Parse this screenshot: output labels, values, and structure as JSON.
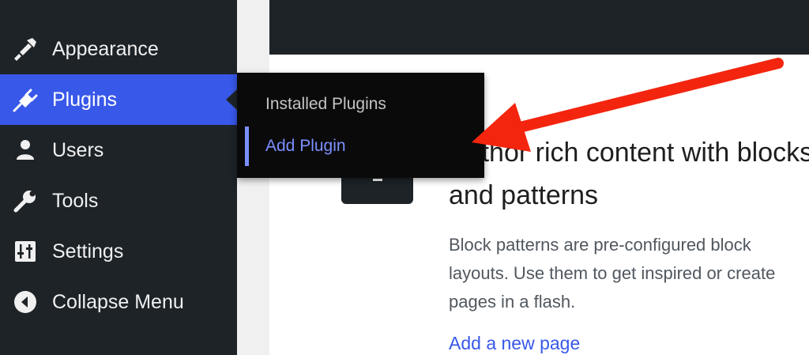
{
  "sidebar": {
    "items": [
      {
        "label": "Appearance",
        "icon": "paintbrush-icon"
      },
      {
        "label": "Plugins",
        "icon": "plugin-icon",
        "active": true
      },
      {
        "label": "Users",
        "icon": "user-icon"
      },
      {
        "label": "Tools",
        "icon": "wrench-icon"
      },
      {
        "label": "Settings",
        "icon": "settings-sliders-icon"
      },
      {
        "label": "Collapse Menu",
        "icon": "collapse-circle-icon"
      }
    ]
  },
  "submenu": {
    "items": [
      {
        "label": "Installed Plugins"
      },
      {
        "label": "Add Plugin",
        "current": true
      }
    ]
  },
  "main": {
    "title_line1": "Author rich content with blocks",
    "title_line2": "and patterns",
    "description_lines": [
      "Block patterns are pre-configured block",
      "layouts. Use them to get inspired or create",
      "pages in a flash."
    ],
    "link": "Add a new page"
  },
  "colors": {
    "sidebar_bg": "#1d2327",
    "active_bg": "#3858e9",
    "submenu_bg": "#0a0a0a",
    "submenu_current": "#7b90ff",
    "link": "#3858e9",
    "annotation_arrow": "#f4250f"
  }
}
